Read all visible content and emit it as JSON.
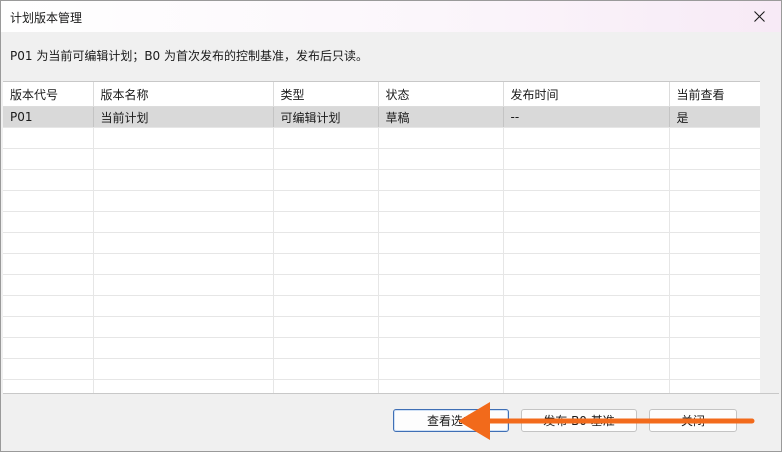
{
  "window": {
    "title": "计划版本管理"
  },
  "info_text": "P01 为当前可编辑计划；B0 为首次发布的控制基准，发布后只读。",
  "table": {
    "columns": [
      "版本代号",
      "版本名称",
      "类型",
      "状态",
      "发布时间",
      "当前查看"
    ],
    "rows": [
      [
        "P01",
        "当前计划",
        "可编辑计划",
        "草稿",
        "--",
        "是"
      ]
    ]
  },
  "buttons": {
    "view_selected": "查看选中",
    "publish_b0": "发布 B0 基准",
    "close": "关闭"
  },
  "colors": {
    "selected_row": "#d9d9d9",
    "arrow": "#f26a1b"
  },
  "icons": {
    "close": "close-icon",
    "annotation": "arrow-left-icon"
  }
}
